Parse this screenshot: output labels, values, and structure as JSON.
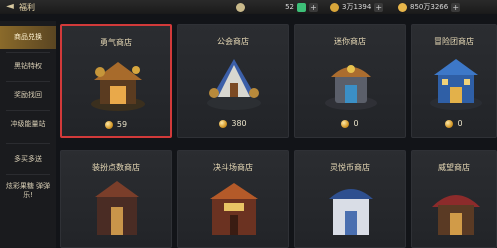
{
  "topbar": {
    "title": "福利",
    "res1_value": "52",
    "res2_value": "3万1394",
    "res3_value": "850万3266"
  },
  "sidebar": {
    "items": [
      {
        "label": "商品兑换"
      },
      {
        "label": "黑钻特权"
      },
      {
        "label": "奖励找回"
      },
      {
        "label": "冲级能量站"
      },
      {
        "label": "多买多送"
      },
      {
        "label": "炫彩果糖 弹弹乐!"
      }
    ]
  },
  "shops": [
    {
      "name": "勇气商店",
      "price": "59"
    },
    {
      "name": "公会商店",
      "price": "380"
    },
    {
      "name": "迷你商店",
      "price": "0"
    },
    {
      "name": "冒险团商店",
      "price": "0"
    },
    {
      "name": "装扮点数商店"
    },
    {
      "name": "决斗场商店"
    },
    {
      "name": "灵悦币商店"
    },
    {
      "name": "威望商店"
    }
  ],
  "colors": {
    "accent": "#8a6a2a",
    "selection": "#d23a3a",
    "coin": "#d59a29"
  }
}
